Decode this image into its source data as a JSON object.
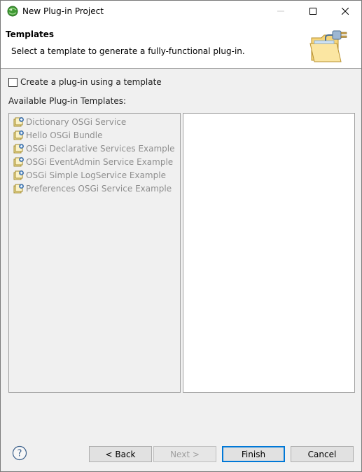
{
  "window": {
    "title": "New Plug-in Project",
    "icon": "eclipse-pde-icon"
  },
  "header": {
    "title": "Templates",
    "description": "Select a template to generate a fully-functional plug-in.",
    "banner_icon": "folder-plug-icon"
  },
  "options": {
    "use_template_label": "Create a plug-in using a template",
    "use_template_checked": false
  },
  "templates": {
    "label": "Available Plug-in Templates:",
    "items": [
      {
        "label": "Dictionary OSGi Service",
        "icon": "template-icon"
      },
      {
        "label": "Hello OSGi Bundle",
        "icon": "template-icon"
      },
      {
        "label": "OSGi Declarative Services Example",
        "icon": "template-icon"
      },
      {
        "label": "OSGi EventAdmin Service Example",
        "icon": "template-icon"
      },
      {
        "label": "OSGi Simple LogService Example",
        "icon": "template-icon"
      },
      {
        "label": "Preferences OSGi Service Example",
        "icon": "template-icon"
      }
    ],
    "enabled": false
  },
  "buttons": {
    "back": "< Back",
    "next": "Next >",
    "finish": "Finish",
    "cancel": "Cancel"
  },
  "colors": {
    "accent": "#0078d7",
    "disabled_text": "#8e8e8e"
  }
}
